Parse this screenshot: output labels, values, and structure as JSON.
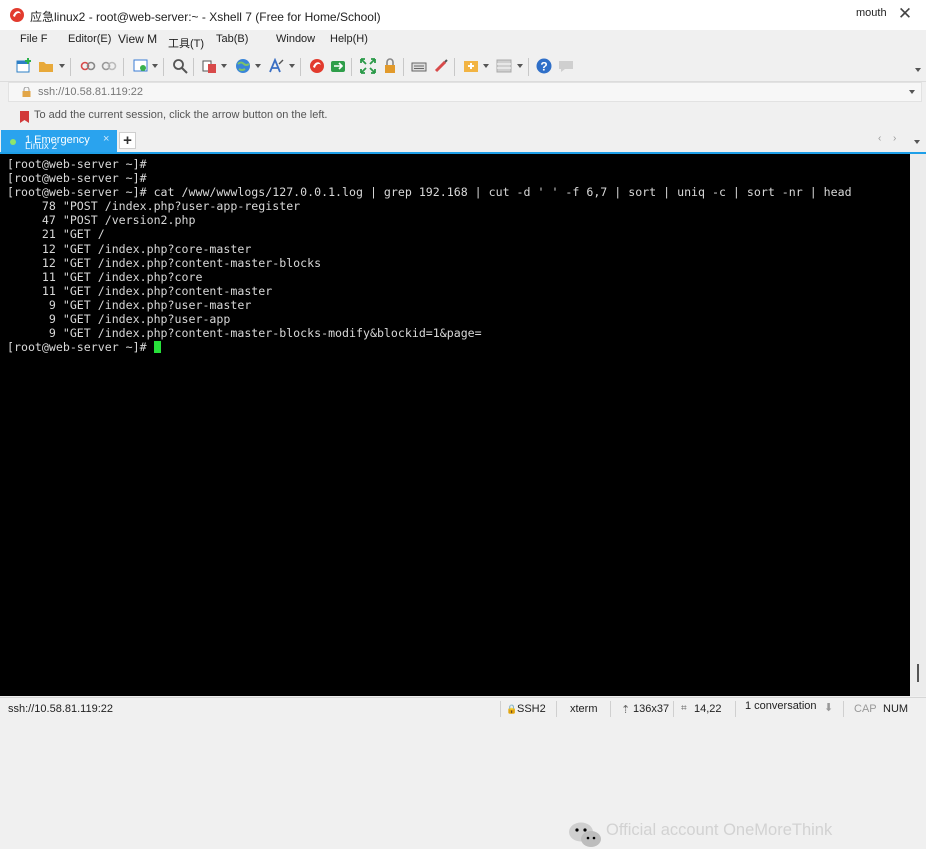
{
  "window": {
    "title": "应急linux2 - root@web-server:~ - Xshell 7 (Free for Home/School)",
    "user": "mouth",
    "close_glyph": "✕"
  },
  "menu": [
    "File F",
    "Editor(E)",
    "View M",
    "工具(T)",
    "Tab(B)",
    "Window",
    "Help(H)"
  ],
  "toolbar": {
    "icons": [
      "new-session-icon",
      "open-folder-icon",
      "connect-icon",
      "disconnect-icon",
      "session-settings-icon",
      "find-icon",
      "copy-paste-icon",
      "globe-icon",
      "font-icon",
      "xshell-icon",
      "xftp-icon",
      "fullscreen-icon",
      "lock-icon",
      "keyboard-icon",
      "script-icon",
      "layout-icon",
      "tile-icon",
      "help-icon",
      "chat-icon"
    ]
  },
  "address": {
    "value": "ssh://10.58.81.119:22"
  },
  "hint": {
    "text": "To add the current session, click the arrow button on the left."
  },
  "tabs": {
    "active_label": "1 Emergency",
    "active_sublabel": "Linux 2",
    "close_glyph": "×",
    "add_glyph": "+",
    "nav_prev": "‹",
    "nav_next": "›"
  },
  "terminal": {
    "lines": [
      "[root@web-server ~]#",
      "[root@web-server ~]#",
      "[root@web-server ~]# cat /www/wwwlogs/127.0.0.1.log | grep 192.168 | cut -d ' ' -f 6,7 | sort | uniq -c | sort -nr | head",
      "     78 \"POST /index.php?user-app-register",
      "     47 \"POST /version2.php",
      "     21 \"GET /",
      "     12 \"GET /index.php?core-master",
      "     12 \"GET /index.php?content-master-blocks",
      "     11 \"GET /index.php?core",
      "     11 \"GET /index.php?content-master",
      "      9 \"GET /index.php?user-master",
      "      9 \"GET /index.php?user-app",
      "      9 \"GET /index.php?content-master-blocks-modify&blockid=1&page="
    ],
    "prompt": "[root@web-server ~]# "
  },
  "watermark": {
    "text": "Official account OneMoreThink"
  },
  "status": {
    "session": "ssh://10.58.81.119:22",
    "protocol": "SSH2",
    "terminal_type": "xterm",
    "size": "136x37",
    "cursor_pos": "14,22",
    "conversations": "1 conversation",
    "caps": "CAP",
    "num": "NUM"
  },
  "colors": {
    "tab_active": "#2aa3ee",
    "terminal_bg": "#000000",
    "terminal_fg": "#d8d8d8",
    "cursor": "#27e03a"
  }
}
